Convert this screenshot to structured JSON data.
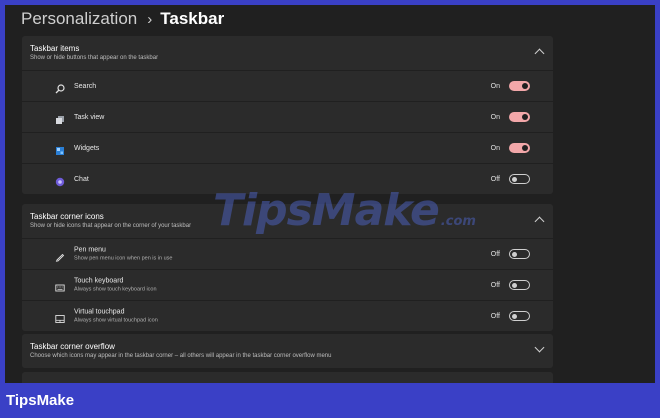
{
  "breadcrumb": {
    "parent": "Personalization",
    "separator": "›",
    "current": "Taskbar"
  },
  "taskbar_items": {
    "title": "Taskbar items",
    "description": "Show or hide buttons that appear on the taskbar",
    "rows": [
      {
        "label": "Search",
        "state": "On",
        "icon": "search-icon",
        "on": true
      },
      {
        "label": "Task view",
        "state": "On",
        "icon": "task-view-icon",
        "on": true
      },
      {
        "label": "Widgets",
        "state": "On",
        "icon": "widgets-icon",
        "on": true
      },
      {
        "label": "Chat",
        "state": "Off",
        "icon": "chat-icon",
        "on": false
      }
    ]
  },
  "corner_icons": {
    "title": "Taskbar corner icons",
    "description": "Show or hide icons that appear on the corner of your taskbar",
    "rows": [
      {
        "label": "Pen menu",
        "description": "Show pen menu icon when pen is in use",
        "state": "Off",
        "icon": "pen-icon",
        "on": false
      },
      {
        "label": "Touch keyboard",
        "description": "Always show touch keyboard icon",
        "state": "Off",
        "icon": "keyboard-icon",
        "on": false
      },
      {
        "label": "Virtual touchpad",
        "description": "Always show virtual touchpad icon",
        "state": "Off",
        "icon": "touchpad-icon",
        "on": false
      }
    ]
  },
  "corner_overflow": {
    "title": "Taskbar corner overflow",
    "description": "Choose which icons may appear in the taskbar corner – all others will appear in the taskbar corner overflow menu"
  },
  "watermark": {
    "main": "TipsMake",
    "suffix": ".com"
  },
  "logo": "TipsMake",
  "colors": {
    "toggle_on": "#f2a7a9",
    "background": "#202020",
    "card": "#2b2b2b",
    "brand": "#3a40c6"
  }
}
